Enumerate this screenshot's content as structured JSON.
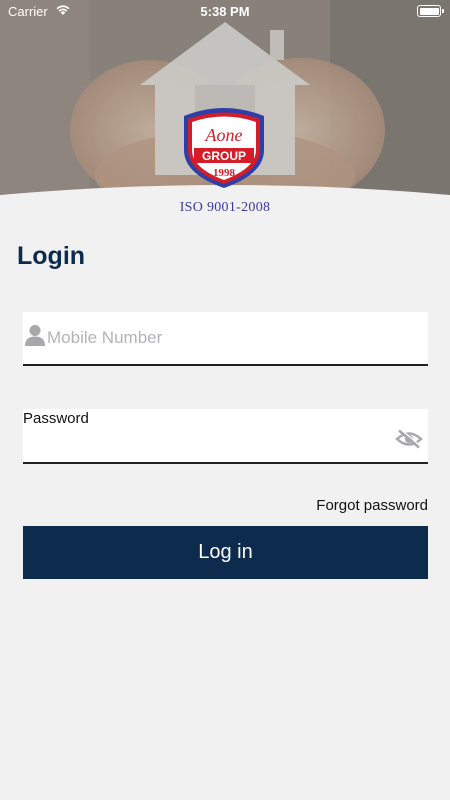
{
  "status_bar": {
    "carrier": "Carrier",
    "time": "5:38 PM",
    "wifi_icon": "wifi-icon",
    "battery_icon": "battery-icon"
  },
  "hero": {
    "logo_top": "Aone",
    "logo_group": "GROUP",
    "logo_year": "1998",
    "iso": "ISO 9001-2008"
  },
  "login": {
    "title": "Login",
    "mobile_placeholder": "Mobile Number",
    "mobile_value": "",
    "password_label": "Password",
    "password_value": "",
    "forgot": "Forgot password",
    "submit": "Log in"
  },
  "colors": {
    "primary": "#0d2b4c",
    "background": "#f1f1f1",
    "logo_red": "#d31e2a",
    "logo_blue": "#2f3ea8"
  }
}
